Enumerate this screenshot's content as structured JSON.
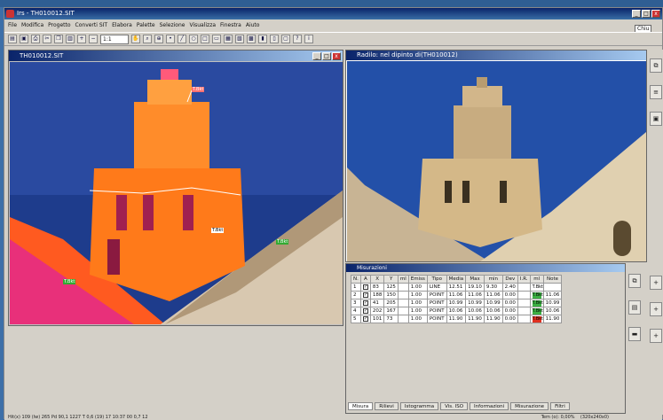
{
  "app": {
    "title": "Irs - TH010012.SIT",
    "selector_text": "Chiu"
  },
  "menu": [
    "File",
    "Modifica",
    "Progetto",
    "Converti SIT",
    "Elabora",
    "Palette",
    "Selezione",
    "Visualizza",
    "Finestra",
    "Aiuto"
  ],
  "toolbar": {
    "zoom_value": "1:1"
  },
  "thermal_window": {
    "title": "TH010012.SIT",
    "labels": [
      {
        "text": "T.Bkt",
        "color": "red"
      },
      {
        "text": "T.Bkt",
        "color": "white"
      },
      {
        "text": "T.Bkt",
        "color": "green"
      },
      {
        "text": "T.Bkt",
        "color": "green"
      }
    ]
  },
  "visible_window": {
    "title": "Radilo: nel dipinto di(TH010012)"
  },
  "measure_window": {
    "title": "Misurazioni",
    "headers": [
      "N.",
      "A",
      "X",
      "Y",
      "ml",
      "Emiss",
      "Tipo",
      "Media",
      "Max",
      "min",
      "Dev",
      "I.R.",
      "ml",
      "Note"
    ],
    "rows": [
      {
        "n": "1",
        "x": "83",
        "y": "125",
        "ml": "",
        "emiss": "1.00",
        "tipo": "LINE",
        "media": "12.51",
        "max": "19.10",
        "min": "9.30",
        "dev": "2.40",
        "ir": "",
        "swatch": "#ffffff",
        "swatch_text": "T.Bkt",
        "note": ""
      },
      {
        "n": "2",
        "x": "188",
        "y": "150",
        "ml": "",
        "emiss": "1.00",
        "tipo": "POINT",
        "media": "11.06",
        "max": "11.06",
        "min": "11.06",
        "dev": "0.00",
        "ir": "",
        "swatch": "#3cb043",
        "swatch_text": "T.Bkt",
        "note": "11.06"
      },
      {
        "n": "3",
        "x": "41",
        "y": "205",
        "ml": "",
        "emiss": "1.00",
        "tipo": "POINT",
        "media": "10.99",
        "max": "10.99",
        "min": "10.99",
        "dev": "0.00",
        "ir": "",
        "swatch": "#3cb043",
        "swatch_text": "T.Bkt",
        "note": "10.99"
      },
      {
        "n": "4",
        "x": "202",
        "y": "167",
        "ml": "",
        "emiss": "1.00",
        "tipo": "POINT",
        "media": "10.06",
        "max": "10.06",
        "min": "10.06",
        "dev": "0.00",
        "ir": "",
        "swatch": "#3cb043",
        "swatch_text": "T.Bkt",
        "note": "10.06"
      },
      {
        "n": "5",
        "x": "101",
        "y": "73",
        "ml": "",
        "emiss": "1.00",
        "tipo": "POINT",
        "media": "11.90",
        "max": "11.90",
        "min": "11.90",
        "dev": "0.00",
        "ir": "",
        "swatch": "#e03020",
        "swatch_text": "T.Bkt",
        "note": "11.90"
      }
    ],
    "tabs": [
      "Misura",
      "Rilievi",
      "Istogramma",
      "Vis. ISO",
      "Informazioni",
      "Misurazione",
      "Filtri"
    ]
  },
  "status": {
    "left": "Hit(x) 109 (Iw) 265 Pd 90,1 1227 T 0,6 (19) 17 10:37 00 0,7 12",
    "right_time": "Tem (o): 0,00%",
    "right_dims": "(320x240x0)"
  },
  "colors": {
    "accent": "#0a246a",
    "thermal_orange": "#ff7a1a",
    "sky": "#1f3a8a"
  }
}
